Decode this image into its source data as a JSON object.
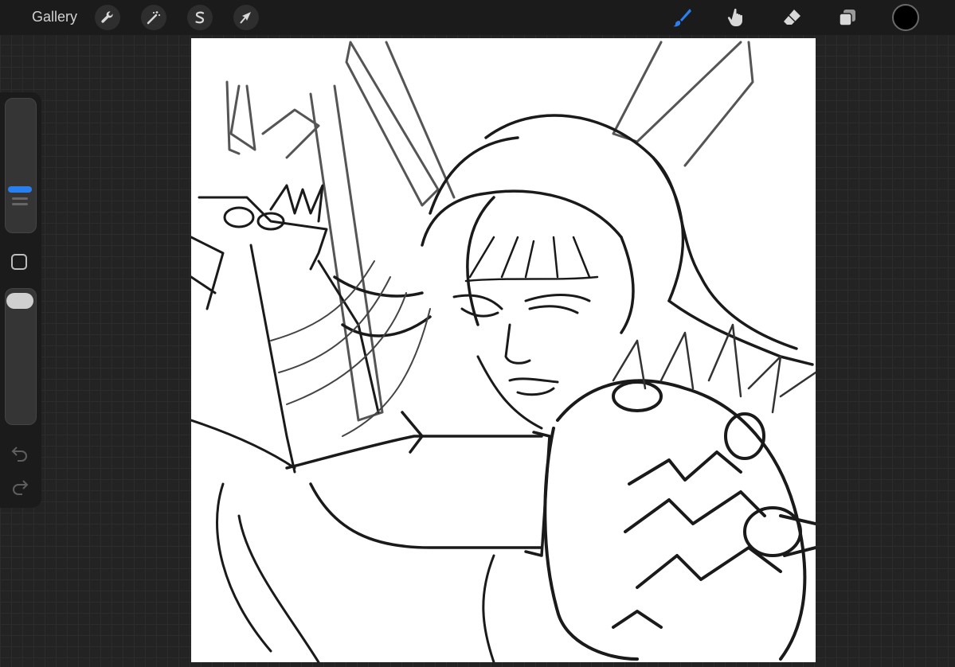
{
  "toolbar": {
    "gallery_label": "Gallery",
    "left_icons": [
      "wrench-icon",
      "magic-wand-icon",
      "selection-s-icon",
      "transform-arrow-icon"
    ],
    "right_icons": [
      "brush-icon",
      "smudge-icon",
      "eraser-icon",
      "layers-icon"
    ],
    "active_tool": "brush",
    "accent_color": "#2a7ff0",
    "current_color": "#000000"
  },
  "sidebar": {
    "brush_size_icon": "brush-size-slider",
    "opacity_icon": "opacity-slider",
    "modify_icon": "square-modify-icon",
    "undo_icon": "undo-icon",
    "redo_icon": "redo-icon"
  },
  "canvas": {
    "background": "#ffffff",
    "content": "sketch-artwork"
  }
}
